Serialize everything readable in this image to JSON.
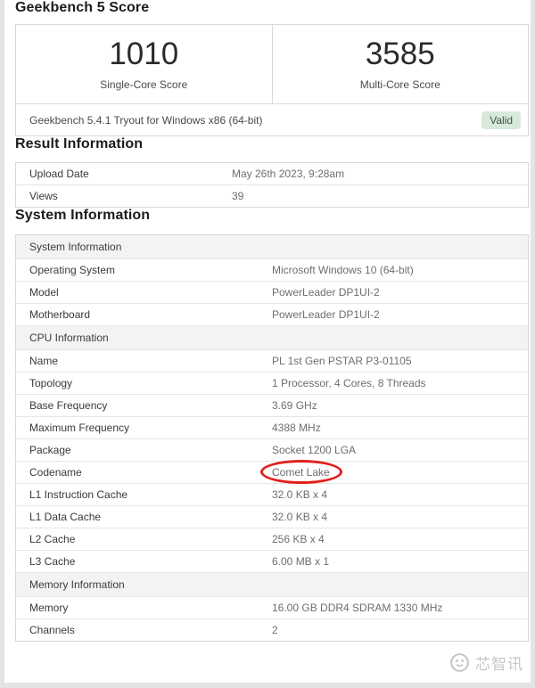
{
  "header": {
    "title": "Geekbench 5 Score"
  },
  "scores": {
    "single": {
      "value": "1010",
      "label": "Single-Core Score"
    },
    "multi": {
      "value": "3585",
      "label": "Multi-Core Score"
    }
  },
  "build": {
    "text": "Geekbench 5.4.1 Tryout for Windows x86 (64-bit)",
    "badge_label": "Valid"
  },
  "sections": {
    "result": {
      "title": "Result Information",
      "rows": [
        {
          "type": "data",
          "label": "Upload Date",
          "value": "May 26th 2023, 9:28am"
        },
        {
          "type": "data",
          "label": "Views",
          "value": "39"
        }
      ]
    },
    "system": {
      "title": "System Information",
      "rows": [
        {
          "type": "subheader",
          "label": "System Information"
        },
        {
          "type": "data",
          "label": "Operating System",
          "value": "Microsoft Windows 10 (64-bit)"
        },
        {
          "type": "data",
          "label": "Model",
          "value": "PowerLeader DP1UI-2"
        },
        {
          "type": "data",
          "label": "Motherboard",
          "value": "PowerLeader DP1UI-2"
        },
        {
          "type": "subheader",
          "label": "CPU Information"
        },
        {
          "type": "data",
          "label": "Name",
          "value": "PL 1st Gen PSTAR P3-01105"
        },
        {
          "type": "data",
          "label": "Topology",
          "value": "1 Processor, 4 Cores, 8 Threads"
        },
        {
          "type": "data",
          "label": "Base Frequency",
          "value": "3.69 GHz"
        },
        {
          "type": "data",
          "label": "Maximum Frequency",
          "value": "4388 MHz"
        },
        {
          "type": "data",
          "label": "Package",
          "value": "Socket 1200 LGA"
        },
        {
          "type": "data",
          "label": "Codename",
          "value": "Comet Lake",
          "annotated": true
        },
        {
          "type": "data",
          "label": "L1 Instruction Cache",
          "value": "32.0 KB x 4"
        },
        {
          "type": "data",
          "label": "L1 Data Cache",
          "value": "32.0 KB x 4"
        },
        {
          "type": "data",
          "label": "L2 Cache",
          "value": "256 KB x 4"
        },
        {
          "type": "data",
          "label": "L3 Cache",
          "value": "6.00 MB x 1"
        },
        {
          "type": "subheader",
          "label": "Memory Information"
        },
        {
          "type": "data",
          "label": "Memory",
          "value": "16.00 GB DDR4 SDRAM 1330 MHz"
        },
        {
          "type": "data",
          "label": "Channels",
          "value": "2"
        }
      ]
    }
  },
  "watermark": {
    "text": "芯智讯",
    "logo_icon": "chip-face-icon"
  },
  "colors": {
    "badge_bg": "#d7ead9",
    "badge_text": "#44504a",
    "annotation_red": "#e0201c",
    "subheader_bg": "#f3f3f3",
    "page_bg": "#e4e4e4"
  }
}
